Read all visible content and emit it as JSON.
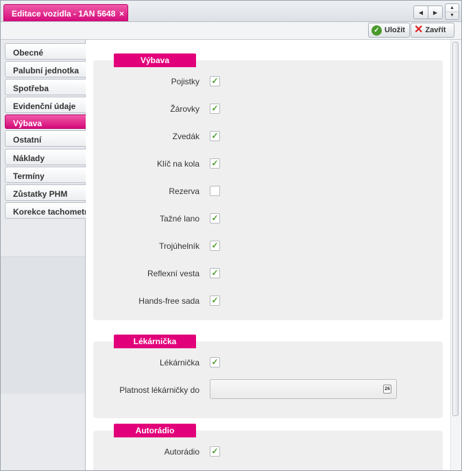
{
  "tab": {
    "title": "Editace vozidla - 1AN 5648",
    "close_glyph": "×"
  },
  "toolbar": {
    "save_label": "Uložit",
    "close_label": "Zavřít"
  },
  "menu": {
    "items": [
      {
        "label": "Obecné"
      },
      {
        "label": "Palubní jednotka"
      },
      {
        "label": "Spotřeba"
      },
      {
        "label": "Evidenční údaje"
      },
      {
        "label": "Výbava"
      },
      {
        "label": "Ostatní"
      },
      {
        "label": "Náklady"
      },
      {
        "label": "Termíny"
      },
      {
        "label": "Zůstatky PHM"
      },
      {
        "label": "Korekce tachometru"
      }
    ],
    "active": "Výbava"
  },
  "sections": {
    "vybava": {
      "title": "Výbava",
      "fields": [
        {
          "label": "Pojistky",
          "checked": true
        },
        {
          "label": "Žárovky",
          "checked": true
        },
        {
          "label": "Zvedák",
          "checked": true
        },
        {
          "label": "Klíč na kola",
          "checked": true
        },
        {
          "label": "Rezerva",
          "checked": false
        },
        {
          "label": "Tažné lano",
          "checked": true
        },
        {
          "label": "Trojúhelník",
          "checked": true
        },
        {
          "label": "Reflexní vesta",
          "checked": true
        },
        {
          "label": "Hands-free sada",
          "checked": true
        }
      ]
    },
    "lekarnicka": {
      "title": "Lékárnička",
      "checkbox": {
        "label": "Lékárnička",
        "checked": true
      },
      "date_field": {
        "label": "Platnost lékárničky do",
        "value": ""
      },
      "calendar_icon_text": "26"
    },
    "autoradio": {
      "title": "Autorádio",
      "checkbox": {
        "label": "Autorádio",
        "checked": true
      }
    }
  },
  "icons": {
    "check": "✓",
    "save": "check-circle-icon",
    "close": "red-x-icon"
  },
  "colors": {
    "accent": "#e2007a",
    "check": "#4b9c2a",
    "close_icon": "#dd2222"
  }
}
